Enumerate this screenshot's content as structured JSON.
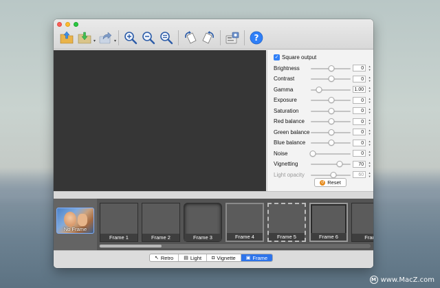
{
  "window": {
    "traffic_lights": [
      "close",
      "minimize",
      "zoom"
    ]
  },
  "toolbar": {
    "buttons": [
      {
        "name": "open-icon",
        "group": 1
      },
      {
        "name": "save-icon",
        "group": 1,
        "dropdown": true
      },
      {
        "name": "share-icon",
        "group": 1,
        "dropdown": true
      },
      {
        "name": "zoom-in-icon",
        "group": 2
      },
      {
        "name": "zoom-out-icon",
        "group": 2
      },
      {
        "name": "zoom-fit-icon",
        "group": 2
      },
      {
        "name": "rotate-left-icon",
        "group": 3
      },
      {
        "name": "rotate-right-icon",
        "group": 3
      },
      {
        "name": "batch-icon",
        "group": 4
      },
      {
        "name": "help-icon",
        "group": 5
      }
    ]
  },
  "panel": {
    "square_output_label": "Square output",
    "square_output_checked": true,
    "rows": [
      {
        "label": "Brightness",
        "value": "0",
        "level": 0.5,
        "disabled": false
      },
      {
        "label": "Contrast",
        "value": "0",
        "level": 0.5,
        "disabled": false
      },
      {
        "label": "Gamma",
        "value": "1.00",
        "level": 0.2,
        "disabled": false
      },
      {
        "label": "Exposure",
        "value": "0",
        "level": 0.5,
        "disabled": false
      },
      {
        "label": "Saturation",
        "value": "0",
        "level": 0.5,
        "disabled": false
      },
      {
        "label": "Red balance",
        "value": "0",
        "level": 0.5,
        "disabled": false
      },
      {
        "label": "Green balance",
        "value": "0",
        "level": 0.5,
        "disabled": false
      },
      {
        "label": "Blue balance",
        "value": "0",
        "level": 0.5,
        "disabled": false
      },
      {
        "label": "Noise",
        "value": "0",
        "level": 0.05,
        "disabled": false
      },
      {
        "label": "Vignetting",
        "value": "70",
        "level": 0.7,
        "disabled": false
      },
      {
        "label": "Light opacity",
        "value": "60",
        "level": 0.55,
        "disabled": true
      }
    ],
    "reset_label": "Reset"
  },
  "filmstrip": {
    "no_frame_label": "No Frame",
    "frames": [
      "Frame 1",
      "Frame 2",
      "Frame 3",
      "Frame 4",
      "Frame 5",
      "Frame 6",
      "Fram"
    ]
  },
  "tabs": [
    {
      "label": "Retro",
      "icon": "retro-icon",
      "active": false
    },
    {
      "label": "Light",
      "icon": "light-icon",
      "active": false
    },
    {
      "label": "Vignette",
      "icon": "vignette-icon",
      "active": false
    },
    {
      "label": "Frame",
      "icon": "frame-icon",
      "active": true
    }
  ],
  "watermark": {
    "text": "www.MacZ.com"
  },
  "colors": {
    "accent": "#2e74ea",
    "checkbox": "#2f7ff7",
    "canvas": "#363636",
    "filmstrip": "#545454"
  }
}
